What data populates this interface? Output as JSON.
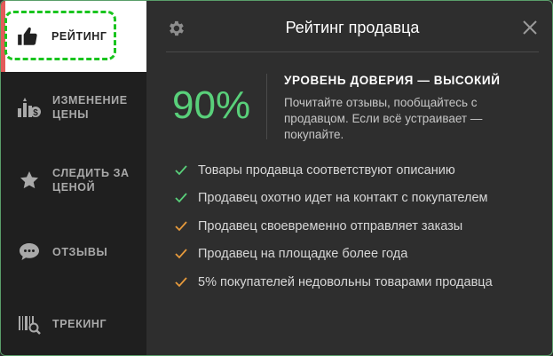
{
  "colors": {
    "accent_green": "#59d07a",
    "warning_orange": "#e69a3c",
    "highlight_dash": "#19c41e",
    "status_red": "#e35a5a"
  },
  "sidebar": {
    "items": [
      {
        "label": "РЕЙТИНГ",
        "icon": "thumbs-up-icon",
        "active": true
      },
      {
        "label": "ИЗМЕНЕНИЕ ЦЕНЫ",
        "icon": "price-change-icon",
        "active": false
      },
      {
        "label": "СЛЕДИТЬ ЗА ЦЕНОЙ",
        "icon": "star-icon",
        "active": false
      },
      {
        "label": "ОТЗЫВЫ",
        "icon": "chat-bubble-icon",
        "active": false
      },
      {
        "label": "ТРЕКИНГ",
        "icon": "barcode-search-icon",
        "active": false
      }
    ]
  },
  "header": {
    "title": "Рейтинг продавца",
    "settings_icon": "gear-icon",
    "close_icon": "close-icon"
  },
  "rating": {
    "percent": "90%",
    "trust_level": "УРОВЕНЬ ДОВЕРИЯ — ВЫСОКИЙ",
    "description": "Почитайте отзывы, пообщайтесь с продавцом. Если всё устраивает — покупайте."
  },
  "criteria": [
    {
      "text": "Товары продавца соответствуют описанию",
      "status": "good"
    },
    {
      "text": "Продавец охотно идет на контакт с покупателем",
      "status": "good"
    },
    {
      "text": "Продавец своевременно отправляет заказы",
      "status": "warning"
    },
    {
      "text": "Продавец на площадке более года",
      "status": "warning"
    },
    {
      "text": "5% покупателей недовольны товарами продавца",
      "status": "warning"
    }
  ]
}
